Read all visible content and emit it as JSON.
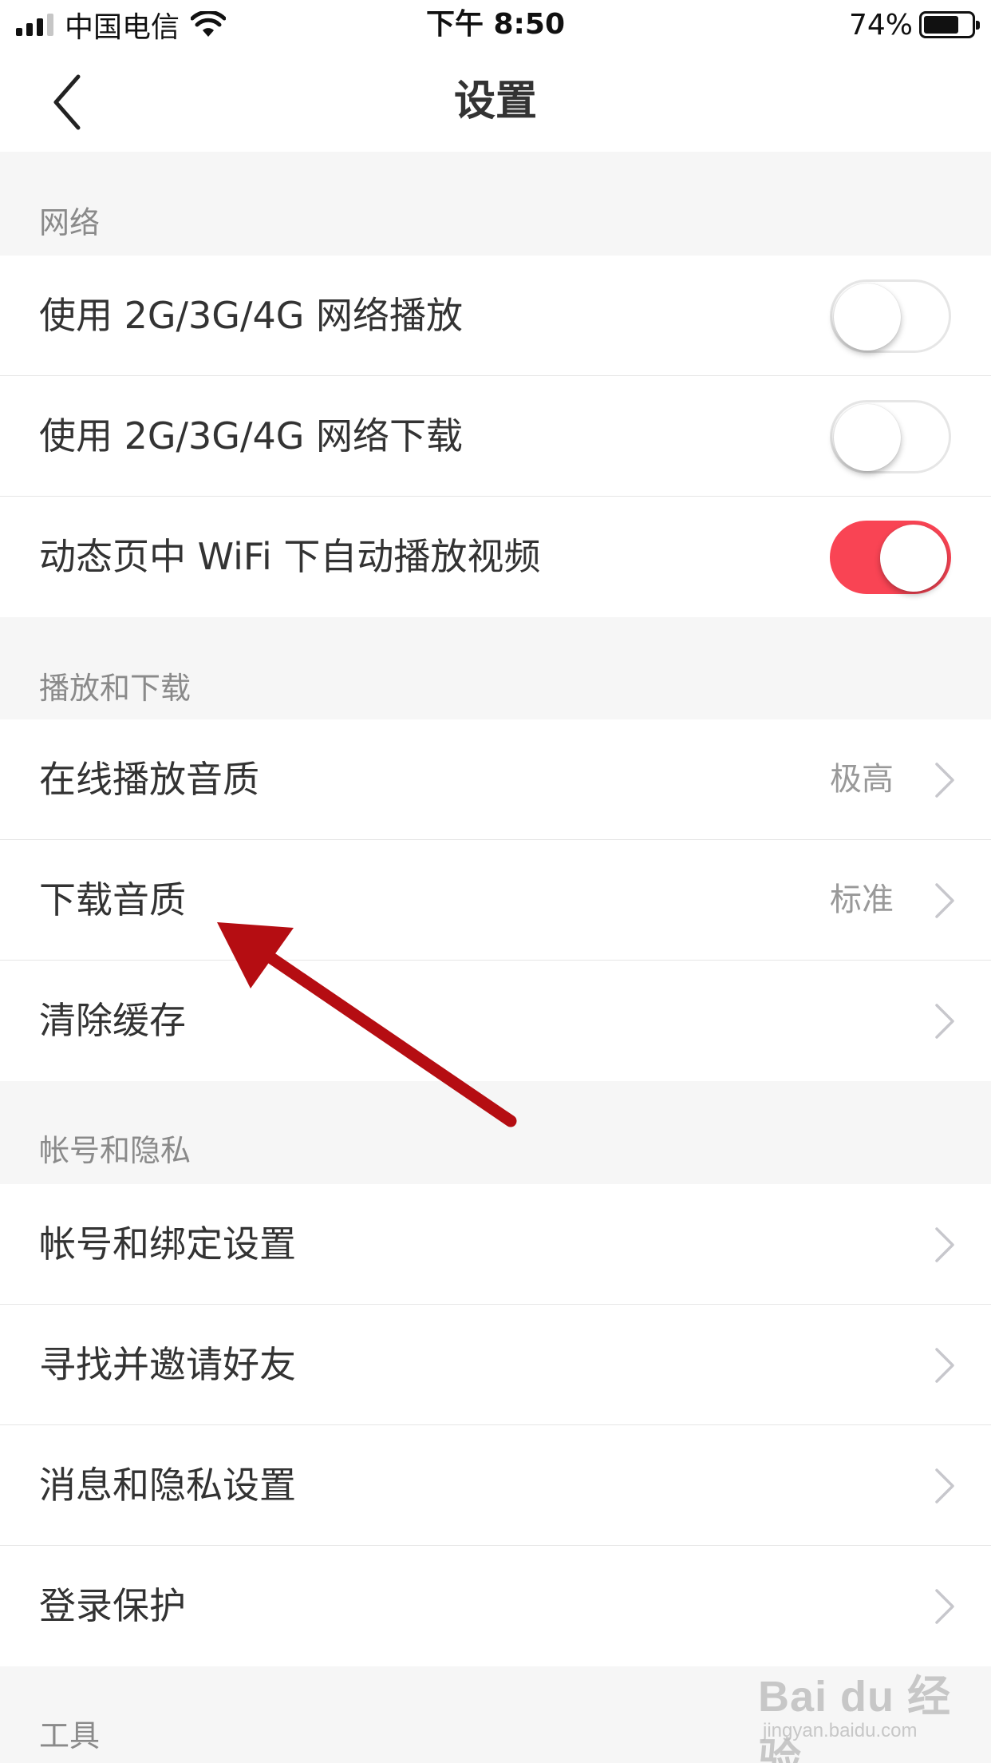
{
  "status_bar": {
    "carrier": "中国电信",
    "time": "下午 8:50",
    "battery": "74%",
    "battery_level": 0.74,
    "signal_bars_active": 3,
    "signal_bars_total": 4
  },
  "nav": {
    "back_icon": "chevron-left-icon",
    "title": "设置"
  },
  "sections": [
    {
      "header": "网络",
      "rows": [
        {
          "label": "使用 2G/3G/4G 网络播放",
          "control": "toggle",
          "on": false
        },
        {
          "label": "使用 2G/3G/4G 网络下载",
          "control": "toggle",
          "on": false
        },
        {
          "label": "动态页中 WiFi 下自动播放视频",
          "control": "toggle",
          "on": true
        }
      ]
    },
    {
      "header": "播放和下载",
      "rows": [
        {
          "label": "在线播放音质",
          "value": "极高",
          "control": "chevron"
        },
        {
          "label": "下载音质",
          "value": "标准",
          "control": "chevron"
        },
        {
          "label": "清除缓存",
          "control": "chevron"
        }
      ]
    },
    {
      "header": "帐号和隐私",
      "rows": [
        {
          "label": "帐号和绑定设置",
          "control": "chevron"
        },
        {
          "label": "寻找并邀请好友",
          "control": "chevron"
        },
        {
          "label": "消息和隐私设置",
          "control": "chevron"
        },
        {
          "label": "登录保护",
          "control": "chevron"
        }
      ]
    },
    {
      "header": "工具",
      "rows": []
    }
  ],
  "colors": {
    "toggle_on": "#f94454",
    "annotation_arrow": "#b50d12",
    "background": "#f6f6f6"
  },
  "watermark": {
    "brand": "Bai du 经验",
    "url": "jingyan.baidu.com"
  }
}
